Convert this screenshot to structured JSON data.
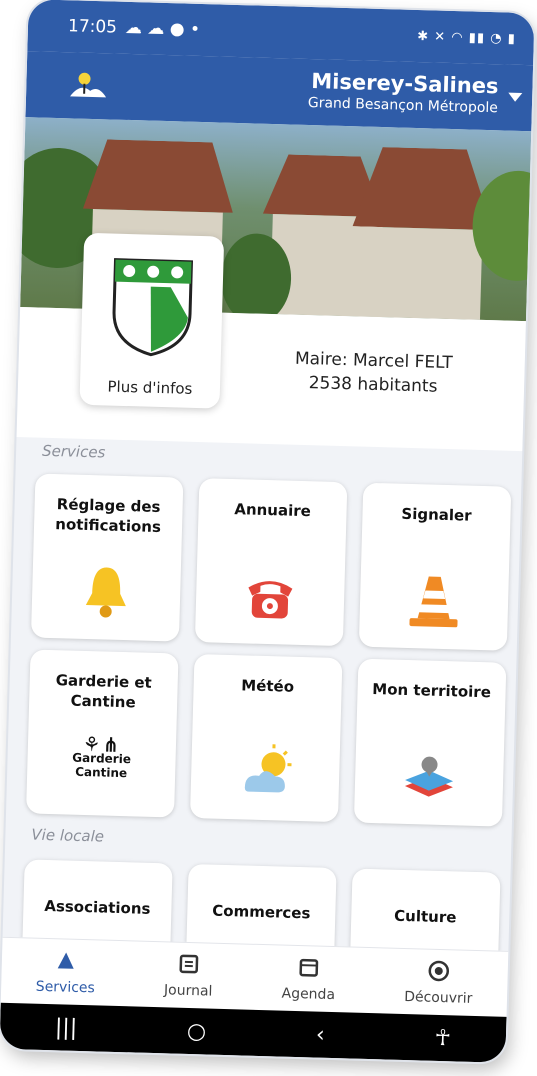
{
  "status": {
    "time": "17:05"
  },
  "header": {
    "city": "Miserey-Salines",
    "subtitle": "Grand Besançon Métropole"
  },
  "info": {
    "more_label": "Plus d'infos",
    "mayor": "Maire: Marcel FELT",
    "population": "2538 habitants"
  },
  "sections": {
    "services": "Services",
    "vie_locale": "Vie locale"
  },
  "tiles": [
    {
      "label": "Réglage des notifications",
      "icon": "bell-icon"
    },
    {
      "label": "Annuaire",
      "icon": "telephone-icon"
    },
    {
      "label": "Signaler",
      "icon": "traffic-cone-icon"
    },
    {
      "label": "Garderie et Cantine",
      "icon": "garderie-cantine-icon"
    },
    {
      "label": "Météo",
      "icon": "weather-icon"
    },
    {
      "label": "Mon territoire",
      "icon": "map-layers-icon"
    },
    {
      "label": "Associations"
    },
    {
      "label": "Commerces"
    },
    {
      "label": "Culture"
    }
  ],
  "garderie_icon_text": [
    "Garderie",
    "Cantine"
  ],
  "nav": [
    {
      "label": "Services",
      "icon": "services-icon",
      "active": true
    },
    {
      "label": "Journal",
      "icon": "journal-icon"
    },
    {
      "label": "Agenda",
      "icon": "calendar-icon"
    },
    {
      "label": "Découvrir",
      "icon": "compass-icon"
    }
  ],
  "colors": {
    "primary": "#2f5ca8",
    "background": "#f1f3f7"
  }
}
